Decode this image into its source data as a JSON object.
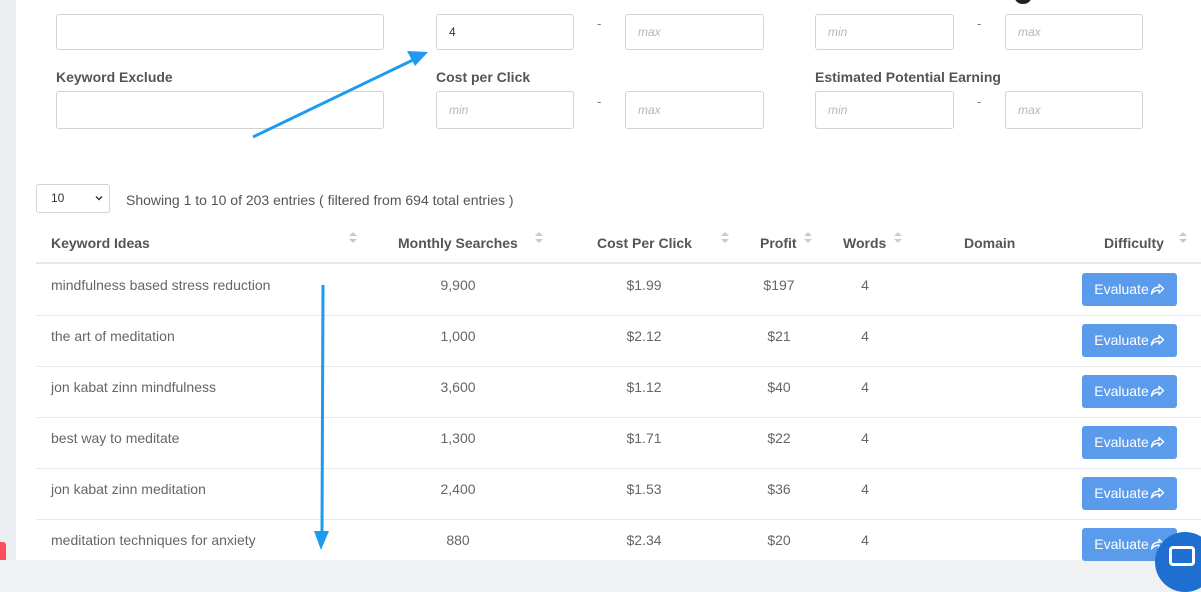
{
  "filters": {
    "keyword_include_value": "",
    "words_min_value": "4",
    "words_max_placeholder": "max",
    "top_right_min_placeholder": "min",
    "top_right_max_placeholder": "max",
    "keyword_exclude_label": "Keyword Exclude",
    "keyword_exclude_value": "",
    "cpc_label": "Cost per Click",
    "cpc_min_placeholder": "min",
    "cpc_max_placeholder": "max",
    "epe_label": "Estimated Potential Earning",
    "epe_min_placeholder": "min",
    "epe_max_placeholder": "max",
    "range_sep": "-"
  },
  "table_controls": {
    "page_length": "10",
    "info": "Showing 1 to 10 of 203 entries ( filtered from 694 total entries )"
  },
  "table": {
    "columns": [
      "Keyword Ideas",
      "Monthly Searches",
      "Cost Per Click",
      "Profit",
      "Words",
      "Domain",
      "Difficulty"
    ],
    "button_label": "Evaluate",
    "rows": [
      {
        "keyword": "mindfulness based stress reduction",
        "searches": "9,900",
        "cpc": "$1.99",
        "profit": "$197",
        "words": "4",
        "domain": ""
      },
      {
        "keyword": "the art of meditation",
        "searches": "1,000",
        "cpc": "$2.12",
        "profit": "$21",
        "words": "4",
        "domain": ""
      },
      {
        "keyword": "jon kabat zinn mindfulness",
        "searches": "3,600",
        "cpc": "$1.12",
        "profit": "$40",
        "words": "4",
        "domain": ""
      },
      {
        "keyword": "best way to meditate",
        "searches": "1,300",
        "cpc": "$1.71",
        "profit": "$22",
        "words": "4",
        "domain": ""
      },
      {
        "keyword": "jon kabat zinn meditation",
        "searches": "2,400",
        "cpc": "$1.53",
        "profit": "$36",
        "words": "4",
        "domain": ""
      },
      {
        "keyword": "meditation techniques for anxiety",
        "searches": "880",
        "cpc": "$2.34",
        "profit": "$20",
        "words": "4",
        "domain": ""
      }
    ]
  },
  "colors": {
    "accent_button": "#5b9bec",
    "annotation_arrow": "#1e9bf0",
    "chat_widget": "#1f6fd1"
  }
}
